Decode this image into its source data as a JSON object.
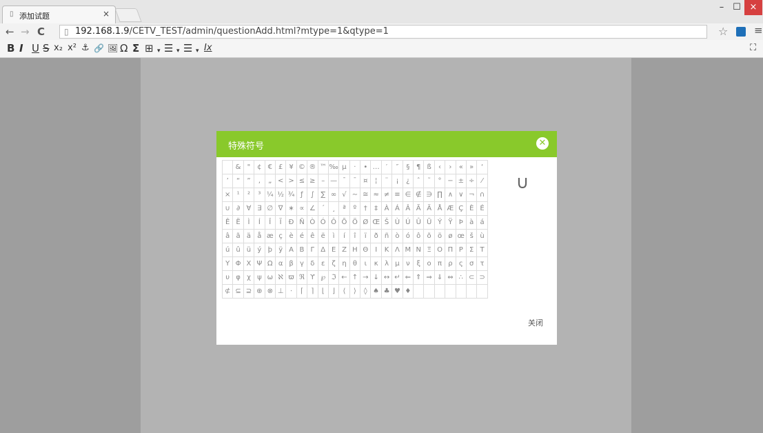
{
  "browser": {
    "tab_title": "添加试题",
    "tab_close": "×",
    "url_host": "192.168.1.9",
    "url_path": "/CETV_TEST/admin/questionAdd.html?mtype=1&qtype=1",
    "window_minimize": "–",
    "window_maximize": "☐",
    "window_close": "×",
    "back": "←",
    "forward": "→",
    "reload": "C",
    "bookmark_star": "☆",
    "menu": "≡"
  },
  "editor_toolbar": {
    "bold": "B",
    "italic": "I",
    "underline": "U",
    "strike": "S",
    "subscript": "x₂",
    "superscript": "x²",
    "anchor": "⚓",
    "link": "🔗",
    "image": "🖼",
    "omega": "Ω",
    "sigma": "Σ",
    "table": "⊞",
    "bullets": "☰",
    "numbers": "☰",
    "clear_format": "Ix",
    "fullscreen": "⛶"
  },
  "dialog": {
    "title": "特殊符号",
    "close_icon": "✕",
    "preview_symbol": "∪",
    "close_label": "关闭",
    "rows": [
      [
        "",
        "&",
        "\"",
        "¢",
        "€",
        "£",
        "¥",
        "©",
        "®",
        "™",
        "‰",
        "µ",
        "·",
        "•",
        "…",
        "′",
        "″",
        "§",
        "¶",
        "ß",
        "‹",
        "›",
        "«",
        "»",
        "‘"
      ],
      [
        "’",
        "“",
        "”",
        "‚",
        "„",
        "<",
        ">",
        "≤",
        "≥",
        "–",
        "—",
        "¯",
        "¯",
        "¤",
        "¦",
        "¨",
        "¡",
        "¿",
        "ˆ",
        "˜",
        "°",
        "−",
        "±",
        "÷",
        "⁄"
      ],
      [
        "×",
        "¹",
        "²",
        "³",
        "¼",
        "½",
        "¾",
        "ƒ",
        "∫",
        "∑",
        "∞",
        "√",
        "∼",
        "≅",
        "≈",
        "≠",
        "≡",
        "∈",
        "∉",
        "∋",
        "∏",
        "∧",
        "∨",
        "¬",
        "∩"
      ],
      [
        "∪",
        "∂",
        "∀",
        "∃",
        "∅",
        "∇",
        "∗",
        "∝",
        "∠",
        "´",
        "¸",
        "ª",
        "º",
        "†",
        "‡",
        "À",
        "Á",
        "Â",
        "Ã",
        "Ä",
        "Å",
        "Æ",
        "Ç",
        "È",
        "É"
      ],
      [
        "Ê",
        "Ë",
        "Ì",
        "Í",
        "Î",
        "Ï",
        "Ð",
        "Ñ",
        "Ò",
        "Ó",
        "Ô",
        "Õ",
        "Ö",
        "Ø",
        "Œ",
        "Š",
        "Ù",
        "Ú",
        "Û",
        "Ü",
        "Ý",
        "Ÿ",
        "Þ",
        "à",
        "á"
      ],
      [
        "â",
        "ã",
        "ä",
        "å",
        "æ",
        "ç",
        "è",
        "é",
        "ê",
        "ë",
        "ì",
        "í",
        "î",
        "ï",
        "ð",
        "ñ",
        "ò",
        "ó",
        "ô",
        "õ",
        "ö",
        "ø",
        "œ",
        "š",
        "ù"
      ],
      [
        "ú",
        "û",
        "ü",
        "ý",
        "þ",
        "ÿ",
        "Α",
        "Β",
        "Γ",
        "Δ",
        "Ε",
        "Ζ",
        "Η",
        "Θ",
        "Ι",
        "Κ",
        "Λ",
        "Μ",
        "Ν",
        "Ξ",
        "Ο",
        "Π",
        "Ρ",
        "Σ",
        "Τ"
      ],
      [
        "Υ",
        "Φ",
        "Χ",
        "Ψ",
        "Ω",
        "α",
        "β",
        "γ",
        "δ",
        "ε",
        "ζ",
        "η",
        "θ",
        "ι",
        "κ",
        "λ",
        "μ",
        "ν",
        "ξ",
        "ο",
        "π",
        "ρ",
        "ς",
        "σ",
        "τ"
      ],
      [
        "υ",
        "φ",
        "χ",
        "ψ",
        "ω",
        "ℵ",
        "ϖ",
        "ℜ",
        "ϒ",
        "℘",
        "ℑ",
        "←",
        "↑",
        "→",
        "↓",
        "↔",
        "↵",
        "⇐",
        "⇑",
        "⇒",
        "⇓",
        "⇔",
        "∴",
        "⊂",
        "⊃"
      ],
      [
        "⊄",
        "⊆",
        "⊇",
        "⊕",
        "⊗",
        "⊥",
        "⋅",
        "⌈",
        "⌉",
        "⌊",
        "⌋",
        "⟨",
        "⟩",
        "◊",
        "♠",
        "♣",
        "♥",
        "♦",
        "",
        "",
        "",
        "",
        "",
        "",
        ""
      ]
    ]
  }
}
